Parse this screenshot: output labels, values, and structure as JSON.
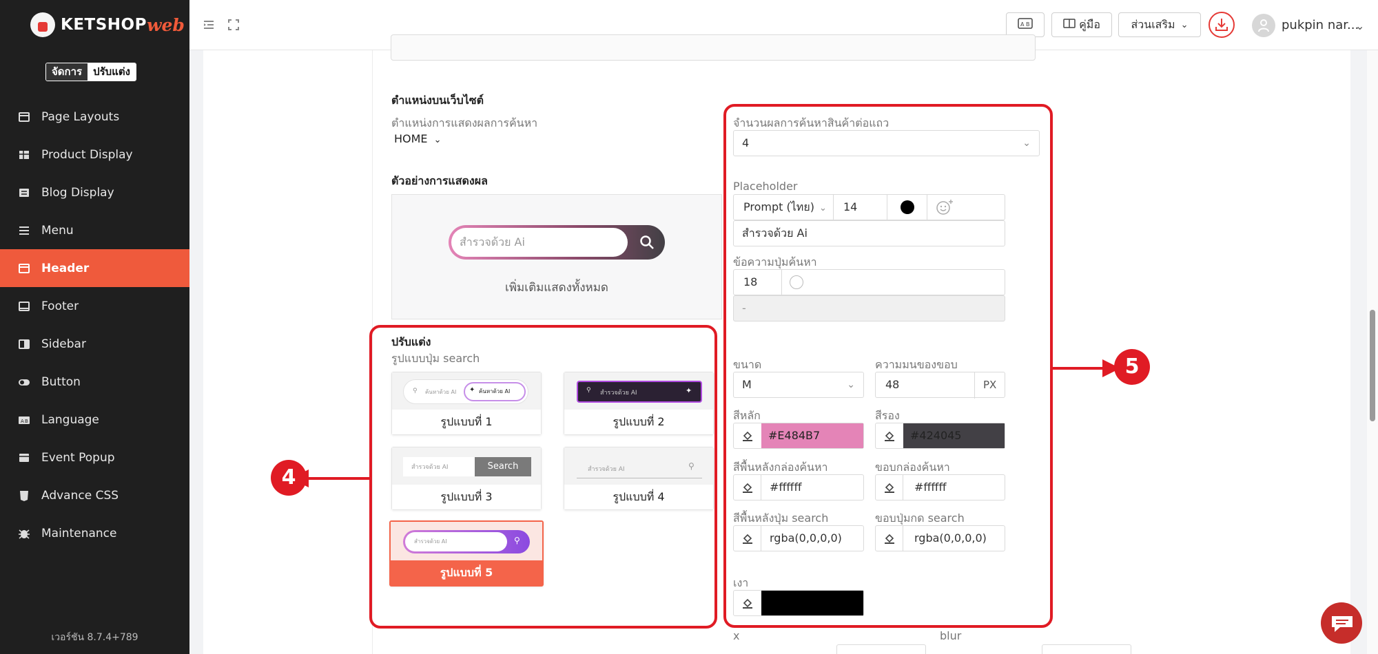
{
  "sidebar": {
    "logo_text": "KETSHOP",
    "logo_web": "web",
    "mode_manage": "จัดการ",
    "mode_customize": "ปรับแต่ง",
    "items": [
      {
        "label": "Page Layouts",
        "icon": "page-layouts-icon"
      },
      {
        "label": "Product Display",
        "icon": "product-display-icon"
      },
      {
        "label": "Blog Display",
        "icon": "blog-display-icon"
      },
      {
        "label": "Menu",
        "icon": "menu-icon"
      },
      {
        "label": "Header",
        "icon": "header-icon",
        "active": true
      },
      {
        "label": "Footer",
        "icon": "footer-icon"
      },
      {
        "label": "Sidebar",
        "icon": "sidebar-icon"
      },
      {
        "label": "Button",
        "icon": "toggle-icon"
      },
      {
        "label": "Language",
        "icon": "language-icon"
      },
      {
        "label": "Event Popup",
        "icon": "event-popup-icon"
      },
      {
        "label": "Advance CSS",
        "icon": "css-icon"
      },
      {
        "label": "Maintenance",
        "icon": "bug-icon"
      }
    ],
    "version": "เวอร์ชัน 8.7.4+789"
  },
  "topbar": {
    "manual_label": "คู่มือ",
    "addons_label": "ส่วนเสริม",
    "username": "pukpin nar..."
  },
  "location": {
    "heading": "ตำแหน่งบนเว็บไซต์",
    "label": "ตำแหน่งการแสดงผลการค้นหา",
    "value": "HOME"
  },
  "preview": {
    "heading": "ตัวอย่างการแสดงผล",
    "placeholder": "สำรวจด้วย Ai",
    "more": "เพิ่มเติมแสดงทั้งหมด"
  },
  "customize": {
    "heading": "ปรับแต่ง",
    "subheading": "รูปแบบปุ่ม search",
    "options": [
      {
        "label": "รูปแบบที่ 1",
        "mini_placeholder": "ค้นหาด้วย AI",
        "mini_button": "ค้นหาด้วย AI"
      },
      {
        "label": "รูปแบบที่ 2",
        "mini_placeholder": "สำรวจด้วย AI"
      },
      {
        "label": "รูปแบบที่ 3",
        "mini_placeholder": "สำรวจด้วย AI",
        "mini_button": "Search"
      },
      {
        "label": "รูปแบบที่ 4",
        "mini_placeholder": "สำรวจด้วย AI"
      },
      {
        "label": "รูปแบบที่ 5",
        "mini_placeholder": "สำรวจด้วย AI",
        "selected": true
      }
    ]
  },
  "form": {
    "per_row_label": "จำนวนผลการค้นหาสินค้าต่อแถว",
    "per_row_value": "4",
    "placeholder_label": "Placeholder",
    "placeholder_font": "Prompt (ไทย)",
    "placeholder_size": "14",
    "placeholder_color": "#000000",
    "placeholder_text": "สำรวจด้วย Ai",
    "button_text_label": "ข้อความปุ่มค้นหา",
    "button_text_size": "18",
    "button_text_value": "-",
    "size_label": "ขนาด",
    "size_value": "M",
    "radius_label": "ความมนของขอบ",
    "radius_value": "48",
    "radius_unit": "PX",
    "primary_label": "สีหลัก",
    "primary_value": "#E484B7",
    "secondary_label": "สีรอง",
    "secondary_value": "#424045",
    "box_bg_label": "สีพื้นหลังกล่องค้นหา",
    "box_bg_value": "#ffffff",
    "box_border_label": "ขอบกล่องค้นหา",
    "box_border_value": "#ffffff",
    "btn_bg_label": "สีพื้นหลังปุ่ม search",
    "btn_bg_value": "rgba(0,0,0,0)",
    "btn_border_label": "ขอบปุ่มกด search",
    "btn_border_value": "rgba(0,0,0,0)",
    "shadow_label": "เงา",
    "shadow_color": "#000000",
    "x_label": "x",
    "blur_label": "blur"
  },
  "annotations": {
    "left_number": "4",
    "right_number": "5"
  },
  "colors": {
    "accent": "#ef5a3c",
    "annotation": "#e01b24",
    "primary": "#E484B7",
    "secondary": "#424045"
  }
}
